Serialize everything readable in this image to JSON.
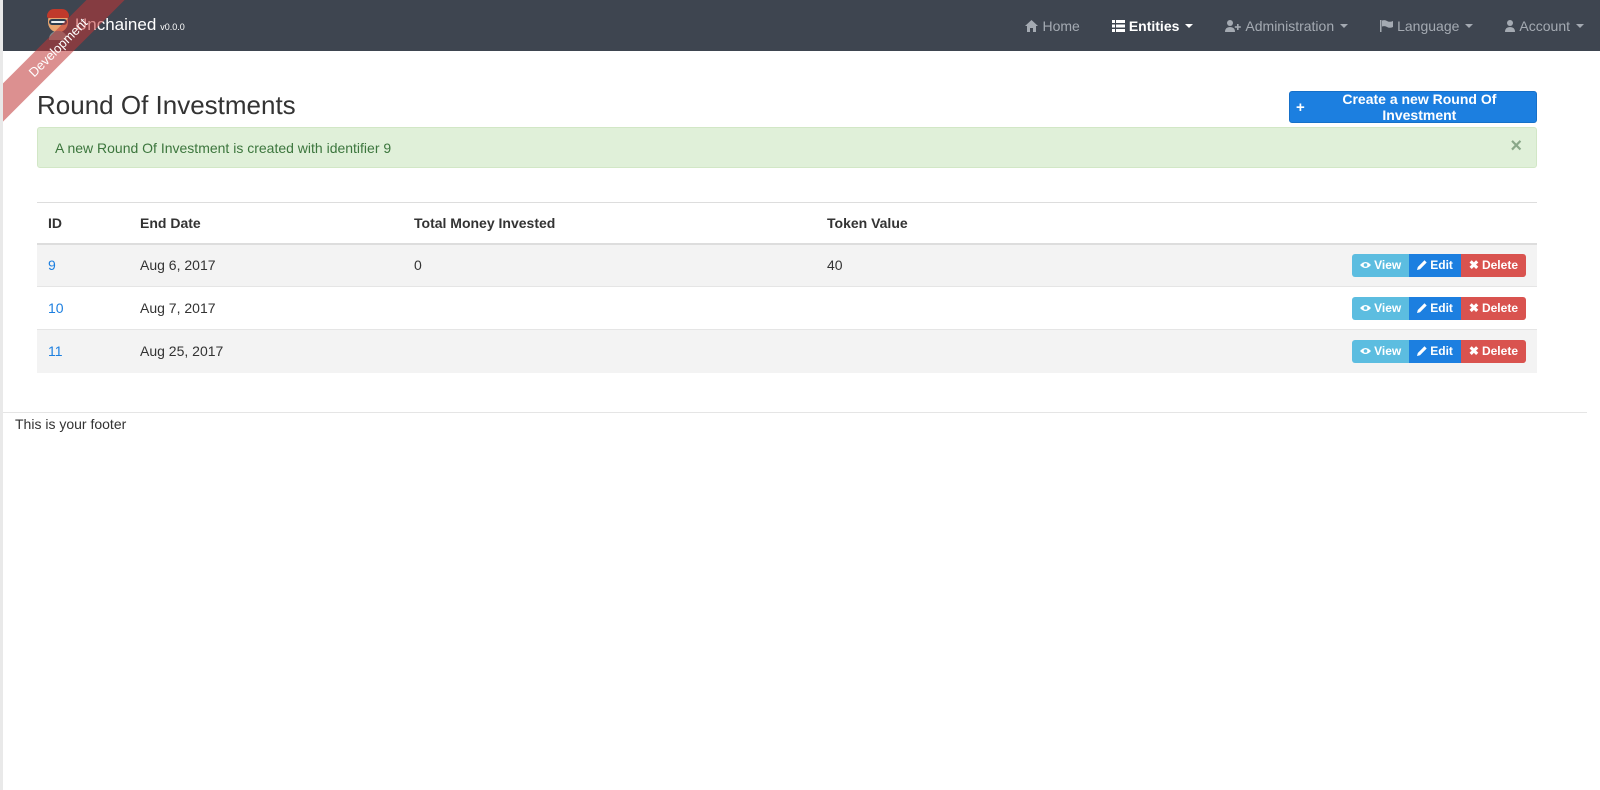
{
  "brand": {
    "name": "Unchained",
    "version": "v0.0.0"
  },
  "ribbon": {
    "label": "Development"
  },
  "nav": {
    "items": [
      {
        "label": "Home",
        "icon": "home-icon",
        "dropdown": false,
        "active": false
      },
      {
        "label": "Entities",
        "icon": "th-list-icon",
        "dropdown": true,
        "active": true
      },
      {
        "label": "Administration",
        "icon": "user-plus-icon",
        "dropdown": true,
        "active": false
      },
      {
        "label": "Language",
        "icon": "flag-icon",
        "dropdown": true,
        "active": false
      },
      {
        "label": "Account",
        "icon": "user-icon",
        "dropdown": true,
        "active": false
      }
    ]
  },
  "page": {
    "title": "Round Of Investments",
    "create_button": "Create a new Round Of Investment"
  },
  "alert": {
    "message": "A new Round Of Investment is created with identifier 9",
    "close": "×"
  },
  "table": {
    "headers": [
      "ID",
      "End Date",
      "Total Money Invested",
      "Token Value"
    ],
    "rows": [
      {
        "id": "9",
        "end_date": "Aug 6, 2017",
        "total_money_invested": "0",
        "token_value": "40"
      },
      {
        "id": "10",
        "end_date": "Aug 7, 2017",
        "total_money_invested": "",
        "token_value": ""
      },
      {
        "id": "11",
        "end_date": "Aug 25, 2017",
        "total_money_invested": "",
        "token_value": ""
      }
    ],
    "actions": {
      "view": "View",
      "edit": "Edit",
      "delete": "Delete"
    }
  },
  "footer": {
    "text": "This is your footer"
  },
  "colors": {
    "navbar": "#3e4550",
    "primary": "#1c7fe0",
    "info": "#5cbde0",
    "danger": "#d9534f",
    "success_bg": "#e0f0d9",
    "success_text": "#3c763d"
  }
}
